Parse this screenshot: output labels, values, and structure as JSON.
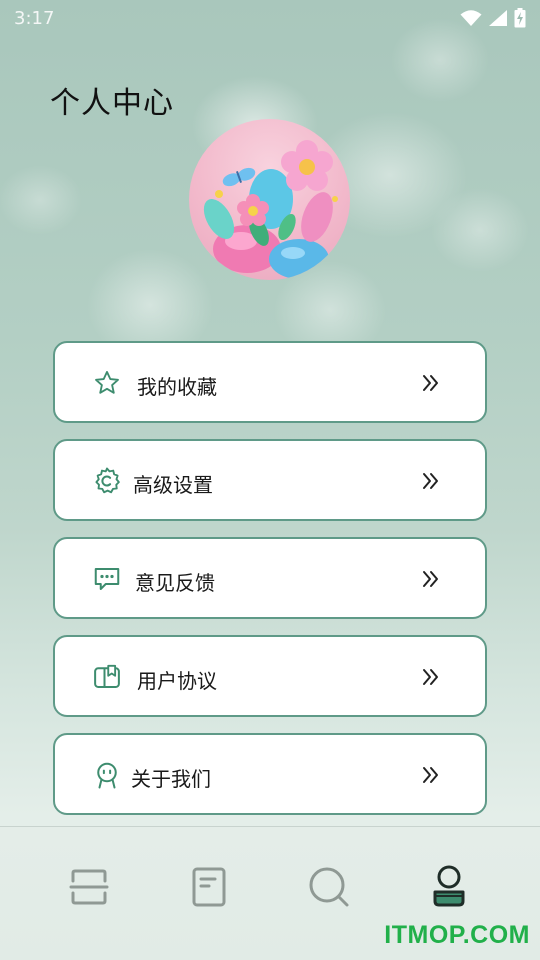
{
  "status_bar": {
    "time": "3:17",
    "icons": [
      "wifi-icon",
      "cellular-signal-icon",
      "battery-charging-icon"
    ]
  },
  "header": {
    "title": "个人中心"
  },
  "profile": {
    "avatar": "flower-balloon-avatar"
  },
  "menu": {
    "items": [
      {
        "icon": "star-icon",
        "label": "我的收藏"
      },
      {
        "icon": "settings-icon",
        "label": "高级设置"
      },
      {
        "icon": "feedback-icon",
        "label": "意见反馈"
      },
      {
        "icon": "user-agreement-icon",
        "label": "用户协议"
      },
      {
        "icon": "about-us-icon",
        "label": "关于我们"
      }
    ]
  },
  "tab_bar": {
    "tabs": [
      {
        "icon": "scan-icon",
        "selected": false
      },
      {
        "icon": "document-icon",
        "selected": false
      },
      {
        "icon": "search-icon",
        "selected": false
      },
      {
        "icon": "profile-icon",
        "selected": true
      }
    ]
  },
  "watermark": {
    "text": "ITMOP.COM"
  },
  "colors": {
    "accent": "#5f9a88",
    "icon_green": "#3d8c6e",
    "watermark_green": "#21b04a"
  }
}
